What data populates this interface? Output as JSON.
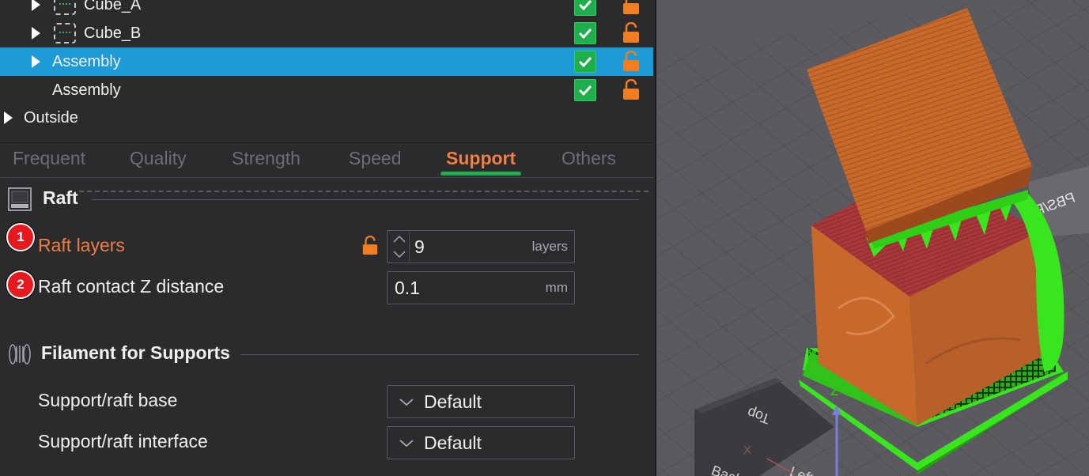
{
  "object_tree": {
    "rows": [
      {
        "label": "Cube_A"
      },
      {
        "label": "Cube_B"
      },
      {
        "label": "Assembly"
      },
      {
        "label": "Assembly"
      },
      {
        "label": "Outside"
      }
    ]
  },
  "tabs": [
    "Frequent",
    "Quality",
    "Strength",
    "Speed",
    "Support",
    "Others"
  ],
  "active_tab": "Support",
  "raft_section": {
    "title": "Raft",
    "params": [
      {
        "badge": "1",
        "label": "Raft layers",
        "value": "9",
        "unit": "layers"
      },
      {
        "badge": "2",
        "label": "Raft contact Z distance",
        "value": "0.1",
        "unit": "mm"
      }
    ]
  },
  "filament_section": {
    "title": "Filament for Supports",
    "params": [
      {
        "label": "Support/raft base",
        "value": "Default"
      },
      {
        "label": "Support/raft interface",
        "value": "Default"
      }
    ]
  },
  "viewport": {
    "cube_faces": {
      "top": "Top",
      "back": "Back",
      "left": "Left"
    },
    "axis_labels": {
      "z": "Z",
      "x": "X"
    },
    "bed_text": "PBS/PE"
  },
  "colors": {
    "selected_row": "#1f9ad8",
    "accent_orange": "#f07e45",
    "check_green": "#1fae4b",
    "badge_red": "#e6191f",
    "print_orange": "#c8692b",
    "support_green": "#39e61e"
  }
}
